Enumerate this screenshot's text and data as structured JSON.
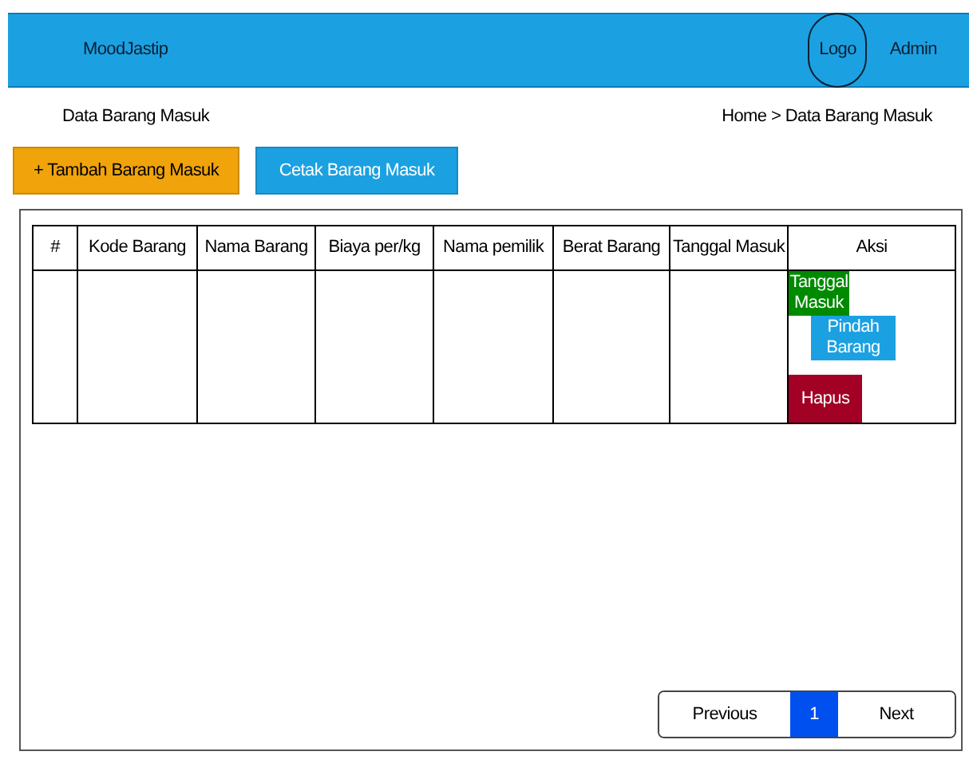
{
  "header": {
    "brand": "MoodJastip",
    "logo": "Logo",
    "user": "Admin"
  },
  "page_title": "Data Barang Masuk",
  "breadcrumb": "Home > Data Barang Masuk",
  "buttons": [
    {
      "label": "+ Tambah Barang Masuk",
      "kind": "add"
    },
    {
      "label": "Cetak Barang Masuk",
      "kind": "print"
    }
  ],
  "table": {
    "columns": [
      "#",
      "Kode Barang",
      "Nama Barang",
      "Biaya per/kg",
      "Nama pemilik",
      "Berat Barang",
      "Tanggal Masuk",
      "Aksi"
    ],
    "rows": [
      {
        "actions": [
          {
            "label": "Tanggal Masuk",
            "kind": "date"
          },
          {
            "label": "Pindah Barang",
            "kind": "move"
          },
          {
            "label": "Hapus",
            "kind": "delete"
          }
        ]
      }
    ]
  },
  "pagination": [
    {
      "label": "Previous",
      "selected": false
    },
    {
      "label": "1",
      "selected": true
    },
    {
      "label": "Next",
      "selected": false
    }
  ]
}
